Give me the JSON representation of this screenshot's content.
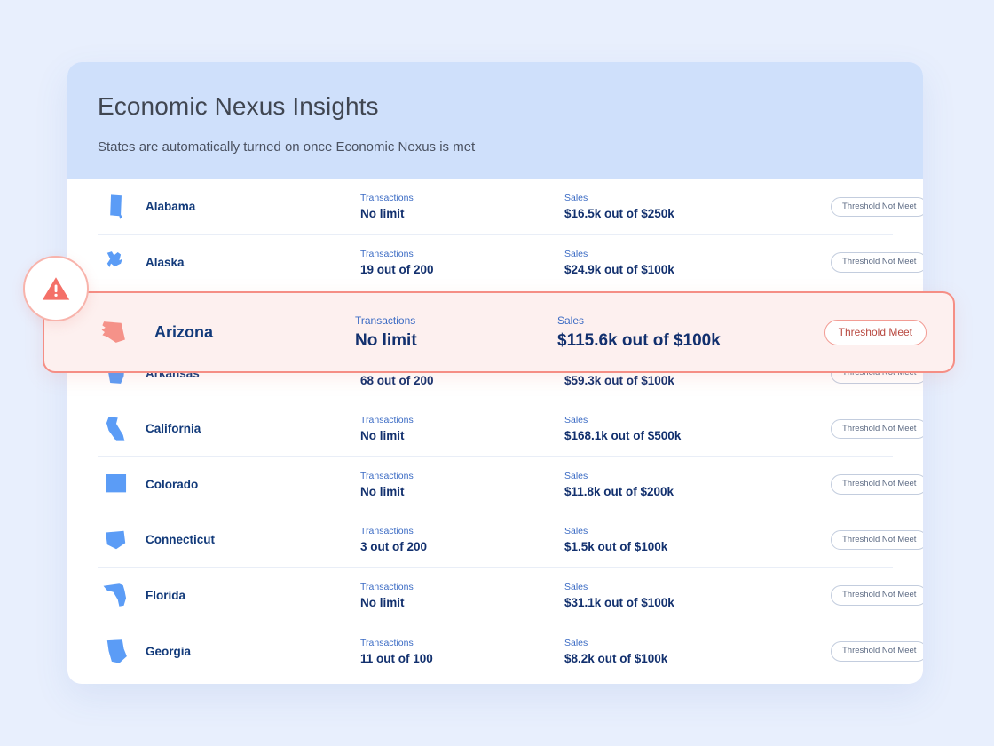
{
  "header": {
    "title": "Economic Nexus Insights",
    "subtitle": "States are automatically turned on once Economic Nexus is met"
  },
  "labels": {
    "transactions": "Transactions",
    "sales": "Sales"
  },
  "badges": {
    "not_met": "Threshold Not Meet",
    "met": "Threshold Meet"
  },
  "colors": {
    "page_background": "#e8effd",
    "header_background": "#cfe0fb",
    "card_background": "#ffffff",
    "state_icon_blue": "#5b9cf6",
    "state_icon_alert": "#f59289",
    "highlight_border": "#f58e85",
    "highlight_fill": "#fdf0ef",
    "alert_red": "#f47068",
    "value_navy": "#12306e",
    "label_blue": "#3b6bc4"
  },
  "warning_icon": "warning-triangle-icon",
  "rows": [
    {
      "state": "Alabama",
      "icon": "state-map-alabama-icon",
      "transactions": "No limit",
      "sales": "$16.5k out of $250k",
      "status": "Threshold Not Meet",
      "met": false
    },
    {
      "state": "Alaska",
      "icon": "state-map-alaska-icon",
      "transactions": "19 out of 200",
      "sales": "$24.9k out of $100k",
      "status": "Threshold Not Meet",
      "met": false
    },
    {
      "state": "Arizona",
      "icon": "state-map-arizona-icon",
      "transactions": "No limit",
      "sales": "$115.6k out of $100k",
      "status": "Threshold Meet",
      "met": true
    },
    {
      "state": "Arkansas",
      "icon": "state-map-arkansas-icon",
      "transactions": "68 out of 200",
      "sales": "$59.3k out of $100k",
      "status": "Threshold Not Meet",
      "met": false
    },
    {
      "state": "California",
      "icon": "state-map-california-icon",
      "transactions": "No limit",
      "sales": "$168.1k out of $500k",
      "status": "Threshold Not Meet",
      "met": false
    },
    {
      "state": "Colorado",
      "icon": "state-map-colorado-icon",
      "transactions": "No limit",
      "sales": "$11.8k out of $200k",
      "status": "Threshold Not Meet",
      "met": false
    },
    {
      "state": "Connecticut",
      "icon": "state-map-connecticut-icon",
      "transactions": "3 out of 200",
      "sales": "$1.5k out of $100k",
      "status": "Threshold Not Meet",
      "met": false
    },
    {
      "state": "Florida",
      "icon": "state-map-florida-icon",
      "transactions": "No limit",
      "sales": "$31.1k out of $100k",
      "status": "Threshold Not Meet",
      "met": false
    },
    {
      "state": "Georgia",
      "icon": "state-map-georgia-icon",
      "transactions": "11 out of 100",
      "sales": "$8.2k out of $100k",
      "status": "Threshold Not Meet",
      "met": false
    }
  ]
}
